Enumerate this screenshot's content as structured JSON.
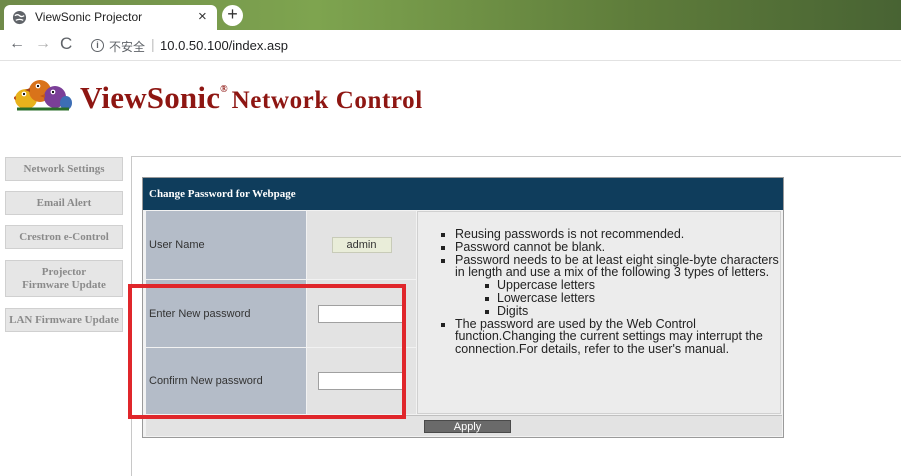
{
  "browser": {
    "tab_title": "ViewSonic Projector",
    "close_glyph": "×",
    "new_tab_glyph": "+",
    "back_glyph": "←",
    "forward_glyph": "→",
    "reload_glyph": "C",
    "info_glyph": "i",
    "security_label": "不安全",
    "separator": "|",
    "url": "10.0.50.100/index.asp"
  },
  "brand": {
    "name": "ViewSonic",
    "registered": "®",
    "subtitle": "Network Control",
    "color": "#8e1612"
  },
  "sidebar": {
    "items": [
      {
        "label": "Network Settings"
      },
      {
        "label": "Email Alert"
      },
      {
        "label": "Crestron e-Control"
      },
      {
        "label": "Projector Firmware Update"
      },
      {
        "label": "LAN Firmware Update"
      }
    ]
  },
  "panel": {
    "title": "Change Password for Webpage",
    "header_color": "#0f3d5c",
    "user_name_label": "User Name",
    "user_name_value": "admin",
    "new_password_label": "Enter New password",
    "new_password_value": "",
    "confirm_password_label": "Confirm New password",
    "confirm_password_value": "",
    "apply_label": "Apply"
  },
  "notes": {
    "items": [
      "Reusing passwords is not recommended.",
      "Password cannot be blank.",
      "Password needs to be at least eight single-byte characters in length and use a mix of the following 3 types of letters."
    ],
    "letter_types": [
      "Uppercase letters",
      "Lowercase letters",
      "Digits"
    ],
    "final": "The password are used by the Web Control function.Changing the current settings may interrupt the connection.For details, refer to the user's manual."
  },
  "annotation": {
    "highlight_color": "#e0262b"
  }
}
